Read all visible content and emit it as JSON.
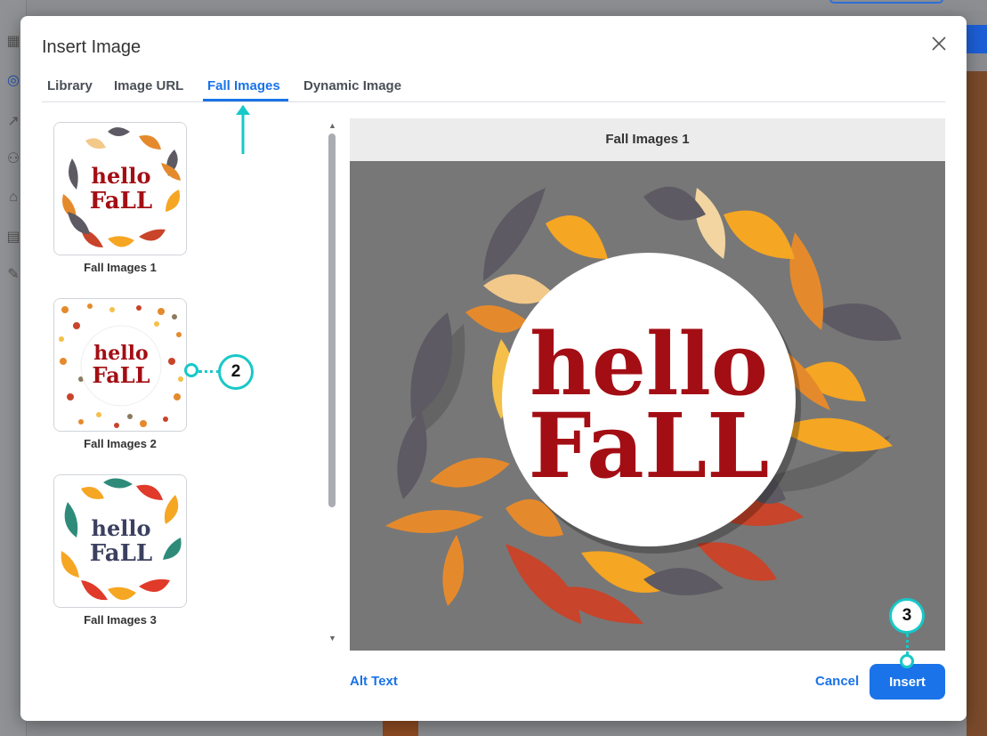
{
  "dialog": {
    "title": "Insert Image"
  },
  "tabs": [
    {
      "label": "Library",
      "active": false
    },
    {
      "label": "Image URL",
      "active": false
    },
    {
      "label": "Fall Images",
      "active": true
    },
    {
      "label": "Dynamic Image",
      "active": false
    }
  ],
  "thumbnails": [
    {
      "label": "Fall Images 1",
      "art_text_top": "hello",
      "art_text_bottom": "FaLL",
      "text_color": "#a30e14"
    },
    {
      "label": "Fall Images 2",
      "art_text_top": "hello",
      "art_text_bottom": "FaLL",
      "text_color": "#a30e14"
    },
    {
      "label": "Fall Images 3",
      "art_text_top": "hello",
      "art_text_bottom": "FaLL",
      "text_color": "#3b4060"
    }
  ],
  "preview": {
    "title": "Fall Images 1",
    "art_text_top": "hello",
    "art_text_bottom": "FaLL"
  },
  "footer": {
    "alt_text_label": "Alt Text",
    "cancel_label": "Cancel",
    "insert_label": "Insert"
  },
  "callouts": {
    "step2": "2",
    "step3": "3"
  },
  "colors": {
    "accent": "#1a73e8",
    "callout": "#18c8c8",
    "preview_bg": "#777777",
    "art_red": "#a30e14"
  }
}
